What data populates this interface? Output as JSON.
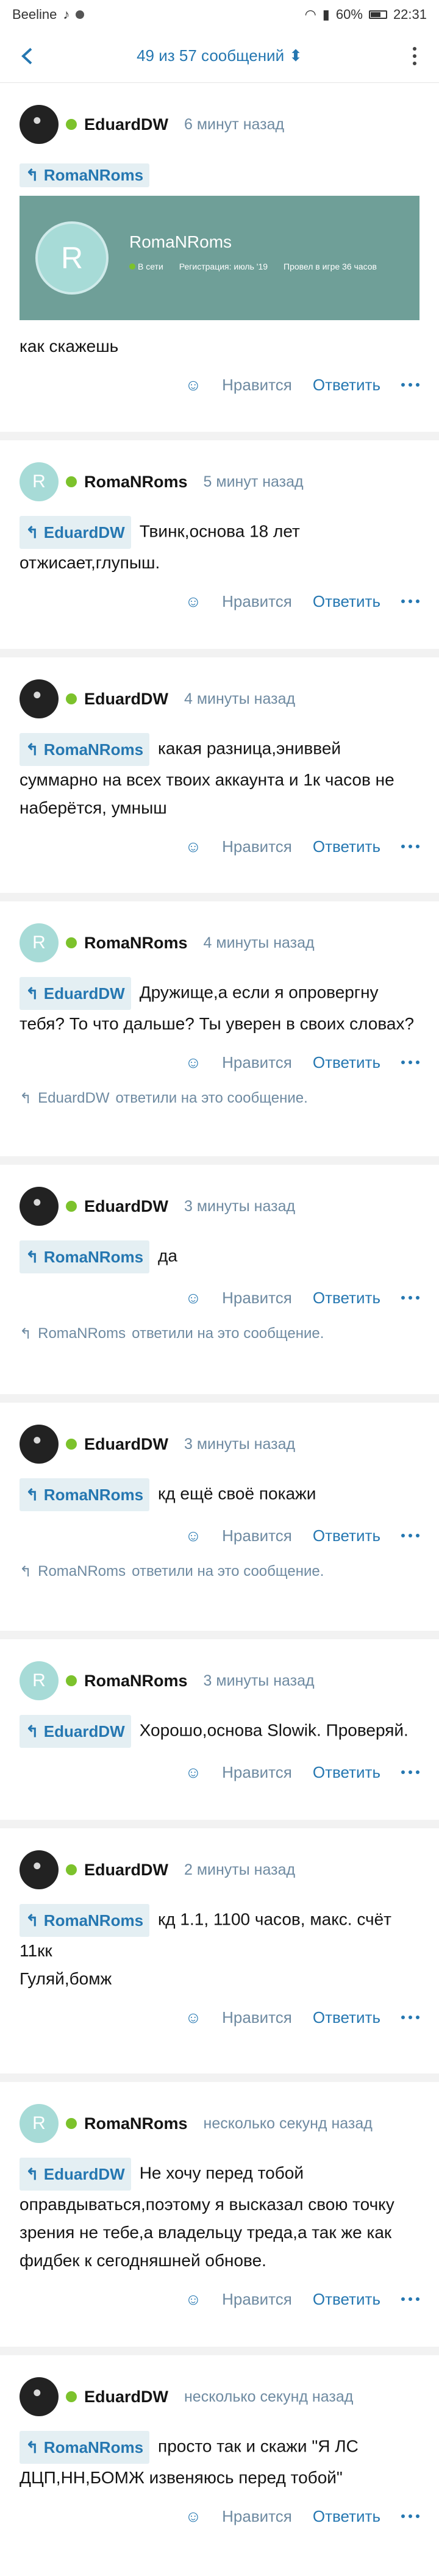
{
  "status": {
    "carrier": "Beeline",
    "battery": "60%",
    "clock": "22:31"
  },
  "nav": {
    "title": "49 из 57 сообщений",
    "title_arrow": "⬍"
  },
  "actions": {
    "like": "Нравится",
    "reply": "Ответить",
    "replied_suffix": "ответили на это сообщение."
  },
  "profile_card": {
    "letter": "R",
    "name": "RomaNRoms",
    "online": "В сети",
    "registered": "Регистрация: июль '19",
    "played": "Провел в игре 36 часов"
  },
  "posts": [
    {
      "author": "EduardDW",
      "time": "6 минут назад",
      "quote": "RomaNRoms",
      "text": "как скажешь",
      "replied_by": ""
    },
    {
      "author": "RomaNRoms",
      "time": "5 минут назад",
      "quote": "EduardDW",
      "text": "Твинк,основа 18 лет отжисает,глупыш.",
      "replied_by": ""
    },
    {
      "author": "EduardDW",
      "time": "4 минуты назад",
      "quote": "RomaNRoms",
      "text": "какая разница,эниввей суммарно на всех твоих аккаунта и 1к часов не наберётся, умныш",
      "replied_by": ""
    },
    {
      "author": "RomaNRoms",
      "time": "4 минуты назад",
      "quote": "EduardDW",
      "text": "Дружище,а если я опровергну тебя? То что дальше? Ты уверен в своих словах?",
      "replied_by": "EduardDW"
    },
    {
      "author": "EduardDW",
      "time": "3 минуты назад",
      "quote": "RomaNRoms",
      "text": "да",
      "replied_by": "RomaNRoms"
    },
    {
      "author": "EduardDW",
      "time": "3 минуты назад",
      "quote": "RomaNRoms",
      "text": "кд ещё своё покажи",
      "replied_by": "RomaNRoms"
    },
    {
      "author": "RomaNRoms",
      "time": "3 минуты назад",
      "quote": "EduardDW",
      "text": "Хорошо,основа Slowik. Проверяй.",
      "replied_by": ""
    },
    {
      "author": "EduardDW",
      "time": "2 минуты назад",
      "quote": "RomaNRoms",
      "text": "кд 1.1, 1100 часов, макс. счёт 11кк",
      "text2": "Гуляй,бомж",
      "replied_by": ""
    },
    {
      "author": "RomaNRoms",
      "time": "несколько секунд назад",
      "quote": "EduardDW",
      "text": "Не хочу перед тобой оправдываться,поэтому я высказал свою точку зрения не тебе,а владельцу треда,а так же как фидбек к сегодняшней обнове.",
      "replied_by": ""
    },
    {
      "author": "EduardDW",
      "time": "несколько секунд назад",
      "quote": "RomaNRoms",
      "text": "просто так и скажи \"Я ЛС ДЦП,НН,БОМЖ извеняюсь перед тобой\"",
      "replied_by": ""
    }
  ]
}
